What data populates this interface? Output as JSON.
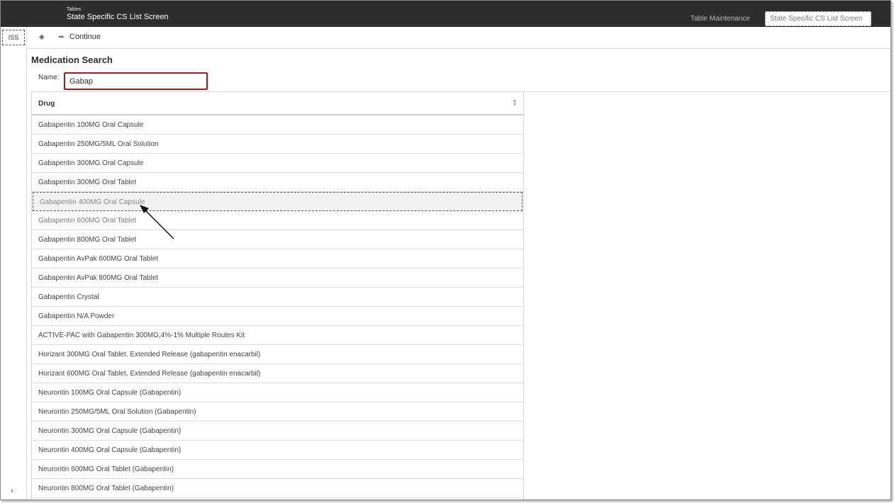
{
  "header": {
    "section": "Tables",
    "title": "State Specific CS List Screen",
    "table_maintenance": "Table Maintenance",
    "breadcrumb": "State Specific CS List Screen"
  },
  "rail": {
    "logo": "ISS",
    "expand": "›"
  },
  "toolbar": {
    "back_icon": "◆",
    "continue_icon": "➡",
    "continue_label": "Continue"
  },
  "search": {
    "title": "Medication Search",
    "name_label": "Name:",
    "name_value": "Gabap"
  },
  "table": {
    "column": "Drug",
    "selected_index": 4,
    "rows": [
      "Gabapentin 100MG Oral Capsule",
      "Gabapentin 250MG/5ML Oral Solution",
      "Gabapentin 300MG Oral Capsule",
      "Gabapentin 300MG Oral Tablet",
      "Gabapentin 400MG Oral Capsule",
      "Gabapentin 600MG Oral Tablet",
      "Gabapentin 800MG Oral Tablet",
      "Gabapentin AvPak 600MG Oral Tablet",
      "Gabapentin AvPak 800MG Oral Tablet",
      "Gabapentin Crystal",
      "Gabapentin N/A Powder",
      "ACTIVE-PAC with Gabapentin 300MG;4%-1% Multiple Routes Kit",
      "Horizant 300MG Oral Tablet, Extended Release (gabapentin enacarbil)",
      "Horizant 600MG Oral Tablet, Extended Release (gabapentin enacarbil)",
      "Neurontin 100MG Oral Capsule (Gabapentin)",
      "Neurontin 250MG/5ML Oral Solution (Gabapentin)",
      "Neurontin 300MG Oral Capsule (Gabapentin)",
      "Neurontin 400MG Oral Capsule (Gabapentin)",
      "Neurontin 600MG Oral Tablet (Gabapentin)",
      "Neurontin 800MG Oral Tablet (Gabapentin)"
    ]
  },
  "colors": {
    "header_bg": "#2d2d2d",
    "input_border": "#9b1c1c"
  }
}
